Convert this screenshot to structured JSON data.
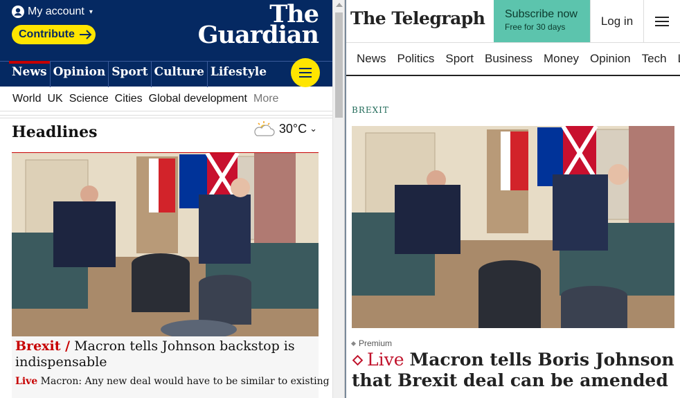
{
  "guardian": {
    "account_label": "My account",
    "contribute_label": "Contribute",
    "logo_line1": "The",
    "logo_line2": "Guardian",
    "nav": [
      "News",
      "Opinion",
      "Sport",
      "Culture",
      "Lifestyle"
    ],
    "subnav": [
      "World",
      "UK",
      "Science",
      "Cities",
      "Global development"
    ],
    "subnav_more": "More",
    "headlines_label": "Headlines",
    "weather_temp": "30°C",
    "article_kicker": "Brexit /",
    "article_title": "Macron tells Johnson backstop is indispensable",
    "live_kicker": "Live",
    "live_text": "Macron: Any new deal would have to be similar to existing one",
    "colors": {
      "brand": "#052962",
      "accent": "#ffe500",
      "news_red": "#c70000"
    }
  },
  "telegraph": {
    "logo": "The Telegraph",
    "subscribe_label": "Subscribe now",
    "subscribe_sub": "Free for 30 days",
    "login_label": "Log in",
    "nav": [
      "News",
      "Politics",
      "Sport",
      "Business",
      "Money",
      "Opinion",
      "Tech",
      "Li"
    ],
    "kicker": "BREXIT",
    "premium_label": "Premium",
    "live_label": "Live",
    "article_title": "Macron tells Boris Johnson that Brexit deal can be amended",
    "colors": {
      "subscribe_bg": "#5cc4ad",
      "live_red": "#c0122b"
    }
  }
}
